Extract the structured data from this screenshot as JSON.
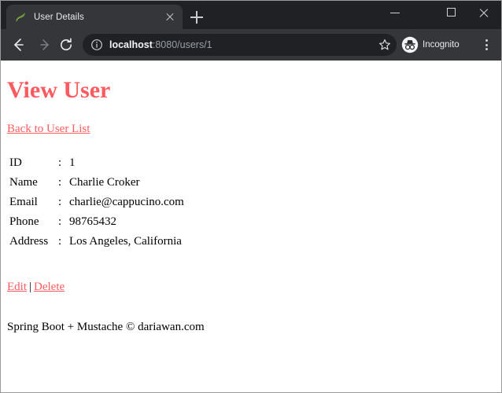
{
  "browser": {
    "tab": {
      "title": "User Details",
      "favicon": "spring-leaf-icon",
      "close_icon": "close-icon"
    },
    "new_tab_label": "+",
    "window_controls": {
      "minimize": "minimize-icon",
      "maximize": "maximize-icon",
      "close": "close-icon"
    },
    "toolbar": {
      "back": "back-arrow-icon",
      "forward": "forward-arrow-icon",
      "reload": "reload-icon",
      "site_info": "info-circle-icon",
      "url_host": "localhost",
      "url_rest": ":8080/users/1",
      "url_full": "localhost:8080/users/1",
      "bookmark": "star-icon",
      "profile_label": "Incognito",
      "profile_icon": "incognito-icon",
      "menu": "three-dots-icon"
    }
  },
  "page": {
    "title": "View User",
    "back_link": "Back to User List",
    "rows": [
      {
        "label": "ID",
        "separator": ":",
        "value": "1"
      },
      {
        "label": "Name",
        "separator": ":",
        "value": "Charlie Croker"
      },
      {
        "label": "Email",
        "separator": ":",
        "value": "charlie@cappucino.com"
      },
      {
        "label": "Phone",
        "separator": ":",
        "value": "98765432"
      },
      {
        "label": "Address",
        "separator": ":",
        "value": "Los Angeles, California"
      }
    ],
    "actions": {
      "edit": "Edit",
      "separator": "|",
      "delete": "Delete"
    },
    "footer": "Spring Boot + Mustache © dariawan.com"
  },
  "colors": {
    "link": "#ff5a5f",
    "heading": "#ff5a5f",
    "page_bg": "#ffffff",
    "chrome_toolbar": "#35363a",
    "chrome_tabstrip": "#202124",
    "omnibox": "#202124"
  }
}
